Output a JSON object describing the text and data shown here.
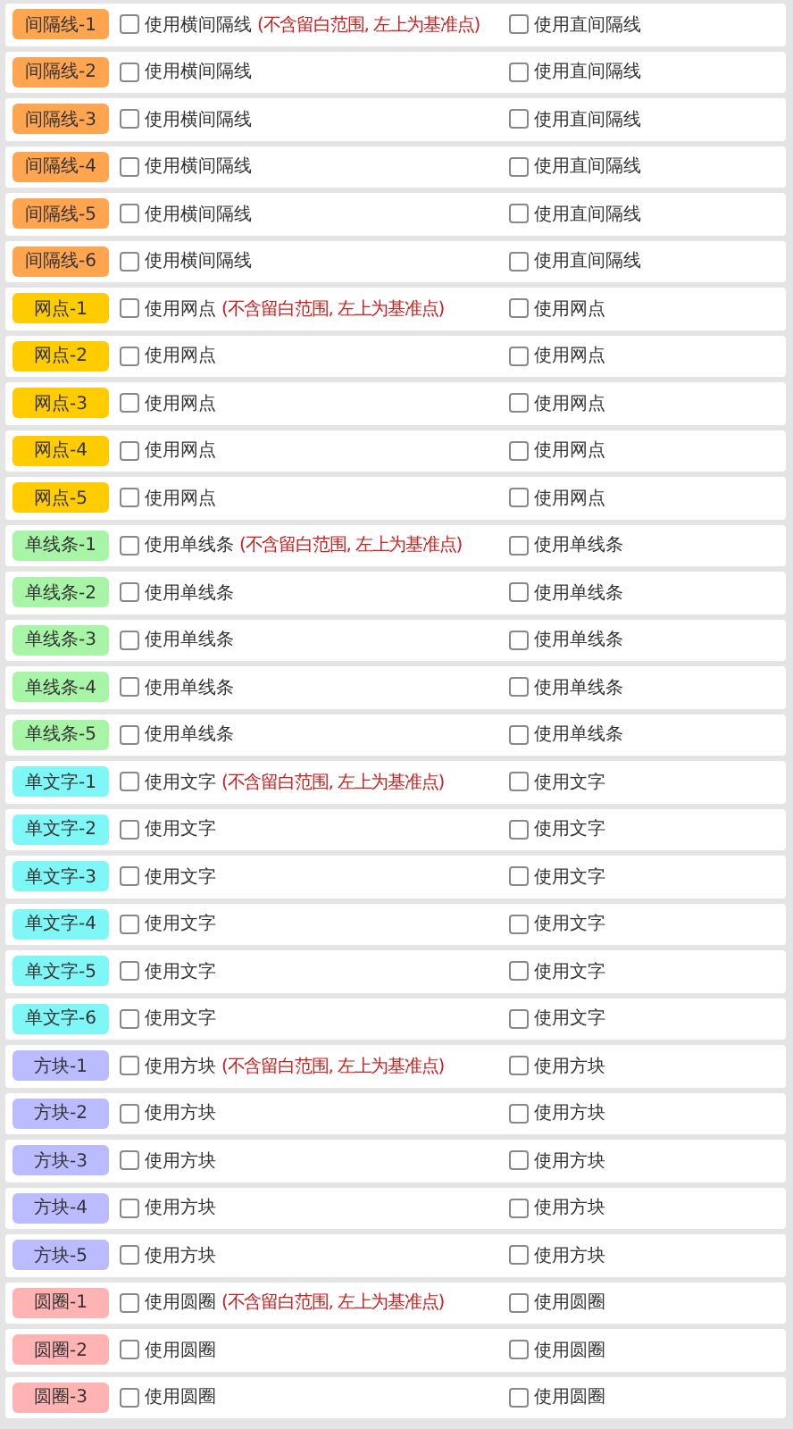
{
  "rows": [
    {
      "label": "间隔线-1",
      "color": "#ffa54f",
      "options": [
        {
          "text": "使用横间隔线",
          "note": "(不含留白范围, 左上为基准点)",
          "checked": false
        },
        {
          "text": "使用直间隔线",
          "checked": false
        }
      ]
    },
    {
      "label": "间隔线-2",
      "color": "#ffa54f",
      "options": [
        {
          "text": "使用横间隔线",
          "checked": false
        },
        {
          "text": "使用直间隔线",
          "checked": false
        }
      ]
    },
    {
      "label": "间隔线-3",
      "color": "#ffa54f",
      "options": [
        {
          "text": "使用横间隔线",
          "checked": false
        },
        {
          "text": "使用直间隔线",
          "checked": false
        }
      ]
    },
    {
      "label": "间隔线-4",
      "color": "#ffa54f",
      "options": [
        {
          "text": "使用横间隔线",
          "checked": false
        },
        {
          "text": "使用直间隔线",
          "checked": false
        }
      ]
    },
    {
      "label": "间隔线-5",
      "color": "#ffa54f",
      "options": [
        {
          "text": "使用横间隔线",
          "checked": false
        },
        {
          "text": "使用直间隔线",
          "checked": false
        }
      ]
    },
    {
      "label": "间隔线-6",
      "color": "#ffa54f",
      "options": [
        {
          "text": "使用横间隔线",
          "checked": false
        },
        {
          "text": "使用直间隔线",
          "checked": false
        }
      ]
    },
    {
      "label": "网点-1",
      "color": "#ffcc00",
      "options": [
        {
          "text": "使用网点",
          "note": "(不含留白范围, 左上为基准点)",
          "checked": false
        },
        {
          "text": "使用网点",
          "checked": false
        }
      ]
    },
    {
      "label": "网点-2",
      "color": "#ffcc00",
      "options": [
        {
          "text": "使用网点",
          "checked": false
        },
        {
          "text": "使用网点",
          "checked": false
        }
      ]
    },
    {
      "label": "网点-3",
      "color": "#ffcc00",
      "options": [
        {
          "text": "使用网点",
          "checked": false
        },
        {
          "text": "使用网点",
          "checked": false
        }
      ]
    },
    {
      "label": "网点-4",
      "color": "#ffcc00",
      "options": [
        {
          "text": "使用网点",
          "checked": false
        },
        {
          "text": "使用网点",
          "checked": false
        }
      ]
    },
    {
      "label": "网点-5",
      "color": "#ffcc00",
      "options": [
        {
          "text": "使用网点",
          "checked": false
        },
        {
          "text": "使用网点",
          "checked": false
        }
      ]
    },
    {
      "label": "单线条-1",
      "color": "#a8f5a8",
      "options": [
        {
          "text": "使用单线条",
          "note": "(不含留白范围, 左上为基准点)",
          "checked": false
        },
        {
          "text": "使用单线条",
          "checked": false
        }
      ]
    },
    {
      "label": "单线条-2",
      "color": "#a8f5a8",
      "options": [
        {
          "text": "使用单线条",
          "checked": false
        },
        {
          "text": "使用单线条",
          "checked": false
        }
      ]
    },
    {
      "label": "单线条-3",
      "color": "#a8f5a8",
      "options": [
        {
          "text": "使用单线条",
          "checked": false
        },
        {
          "text": "使用单线条",
          "checked": false
        }
      ]
    },
    {
      "label": "单线条-4",
      "color": "#a8f5a8",
      "options": [
        {
          "text": "使用单线条",
          "checked": false
        },
        {
          "text": "使用单线条",
          "checked": false
        }
      ]
    },
    {
      "label": "单线条-5",
      "color": "#a8f5a8",
      "options": [
        {
          "text": "使用单线条",
          "checked": false
        },
        {
          "text": "使用单线条",
          "checked": false
        }
      ]
    },
    {
      "label": "单文字-1",
      "color": "#7ff7f7",
      "options": [
        {
          "text": "使用文字",
          "note": "(不含留白范围, 左上为基准点)",
          "checked": false
        },
        {
          "text": "使用文字",
          "checked": false
        }
      ]
    },
    {
      "label": "单文字-2",
      "color": "#7ff7f7",
      "options": [
        {
          "text": "使用文字",
          "checked": false
        },
        {
          "text": "使用文字",
          "checked": false
        }
      ]
    },
    {
      "label": "单文字-3",
      "color": "#7ff7f7",
      "options": [
        {
          "text": "使用文字",
          "checked": false
        },
        {
          "text": "使用文字",
          "checked": false
        }
      ]
    },
    {
      "label": "单文字-4",
      "color": "#7ff7f7",
      "options": [
        {
          "text": "使用文字",
          "checked": false
        },
        {
          "text": "使用文字",
          "checked": false
        }
      ]
    },
    {
      "label": "单文字-5",
      "color": "#7ff7f7",
      "options": [
        {
          "text": "使用文字",
          "checked": false
        },
        {
          "text": "使用文字",
          "checked": false
        }
      ]
    },
    {
      "label": "单文字-6",
      "color": "#7ff7f7",
      "options": [
        {
          "text": "使用文字",
          "checked": false
        },
        {
          "text": "使用文字",
          "checked": false
        }
      ]
    },
    {
      "label": "方块-1",
      "color": "#bbbbff",
      "options": [
        {
          "text": "使用方块",
          "note": "(不含留白范围, 左上为基准点)",
          "checked": false
        },
        {
          "text": "使用方块",
          "checked": false
        }
      ]
    },
    {
      "label": "方块-2",
      "color": "#bbbbff",
      "options": [
        {
          "text": "使用方块",
          "checked": false
        },
        {
          "text": "使用方块",
          "checked": false
        }
      ]
    },
    {
      "label": "方块-3",
      "color": "#bbbbff",
      "options": [
        {
          "text": "使用方块",
          "checked": false
        },
        {
          "text": "使用方块",
          "checked": false
        }
      ]
    },
    {
      "label": "方块-4",
      "color": "#bbbbff",
      "options": [
        {
          "text": "使用方块",
          "checked": false
        },
        {
          "text": "使用方块",
          "checked": false
        }
      ]
    },
    {
      "label": "方块-5",
      "color": "#bbbbff",
      "options": [
        {
          "text": "使用方块",
          "checked": false
        },
        {
          "text": "使用方块",
          "checked": false
        }
      ]
    },
    {
      "label": "圆圈-1",
      "color": "#ffb3b3",
      "options": [
        {
          "text": "使用圆圈",
          "note": "(不含留白范围, 左上为基准点)",
          "checked": false
        },
        {
          "text": "使用圆圈",
          "checked": false
        }
      ]
    },
    {
      "label": "圆圈-2",
      "color": "#ffb3b3",
      "options": [
        {
          "text": "使用圆圈",
          "checked": false
        },
        {
          "text": "使用圆圈",
          "checked": false
        }
      ]
    },
    {
      "label": "圆圈-3",
      "color": "#ffb3b3",
      "options": [
        {
          "text": "使用圆圈",
          "checked": false
        },
        {
          "text": "使用圆圈",
          "checked": false
        }
      ]
    }
  ]
}
